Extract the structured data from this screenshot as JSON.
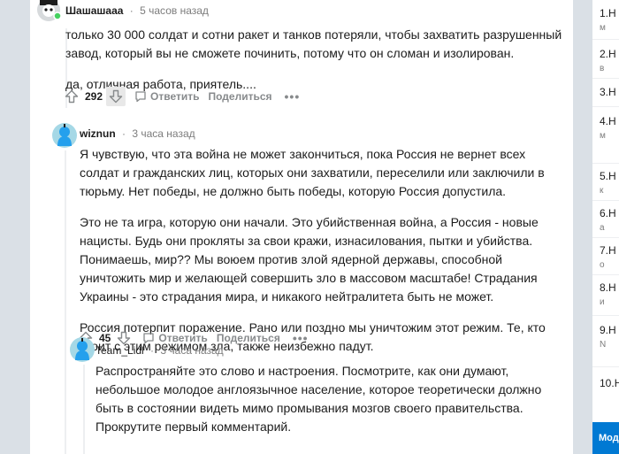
{
  "comments": [
    {
      "user": "Шашашааа",
      "time": "5 часов назад",
      "paragraphs": [
        "только 30 000 солдат и сотни ракет и танков потеряли, чтобы захватить разрушенный завод, который вы не сможете починить, потому что он сломан и изолирован.",
        "да, отличная работа, приятель...."
      ],
      "score": "292"
    },
    {
      "user": "wiznun",
      "time": "3 часа назад",
      "paragraphs": [
        "Я чувствую, что эта война не может закончиться, пока Россия не вернет всех солдат и гражданских лиц, которых они захватили, переселили или заключили в тюрьму. Нет победы, не должно быть победы, которую Россия допустила.",
        "Это не та игра, которую они начали. Это убийственная война, а Россия - новые нацисты. Будь они прокляты за свои кражи, изнасилования, пытки и убийства. Понимаешь, мир?? Мы воюем против злой ядерной державы, способной уничтожить мир и желающей совершить зло в массовом масштабе! Страдания Украины - это страдания мира, и никакого нейтралитета быть не может.",
        "Россия потерпит поражение. Рано или поздно мы уничтожим этот режим. Те, кто стоит с этим режимом зла, также неизбежно падут."
      ],
      "score": "45"
    },
    {
      "user": "Team_Lidl",
      "time": "3 часа назад",
      "paragraphs": [
        "Распространяйте это слово и настроения. Посмотрите, как они думают, небольшое молодое англоязычное население, которое теоретически должно быть в состоянии видеть мимо промывания мозгов своего правительства. Прокрутите первый комментарий."
      ]
    }
  ],
  "actions": {
    "reply": "Ответить",
    "share": "Поделиться",
    "more": "•••"
  },
  "separator": "·",
  "sidebar": {
    "items": [
      {
        "rank": "1.",
        "text": "Н",
        "sub": "м"
      },
      {
        "rank": "2.",
        "text": "Н",
        "sub": "в"
      },
      {
        "rank": "3.",
        "text": "Н"
      },
      {
        "rank": "4.",
        "text": "Н",
        "sub": "м"
      },
      {
        "rank": "5.",
        "text": "Н",
        "sub": "к"
      },
      {
        "rank": "6.",
        "text": "Н",
        "sub": "а"
      },
      {
        "rank": "7.",
        "text": "Н",
        "sub": "о"
      },
      {
        "rank": "8.",
        "text": "Н",
        "sub": "и"
      },
      {
        "rank": "9.",
        "text": "Н",
        "sub": "N"
      },
      {
        "rank": "10.",
        "text": "Н"
      }
    ],
    "button": "Мод"
  },
  "colors": {
    "accent": "#0079d3",
    "background": "#dae0e6",
    "meta": "#7c7c7c",
    "action": "#878a8c"
  }
}
